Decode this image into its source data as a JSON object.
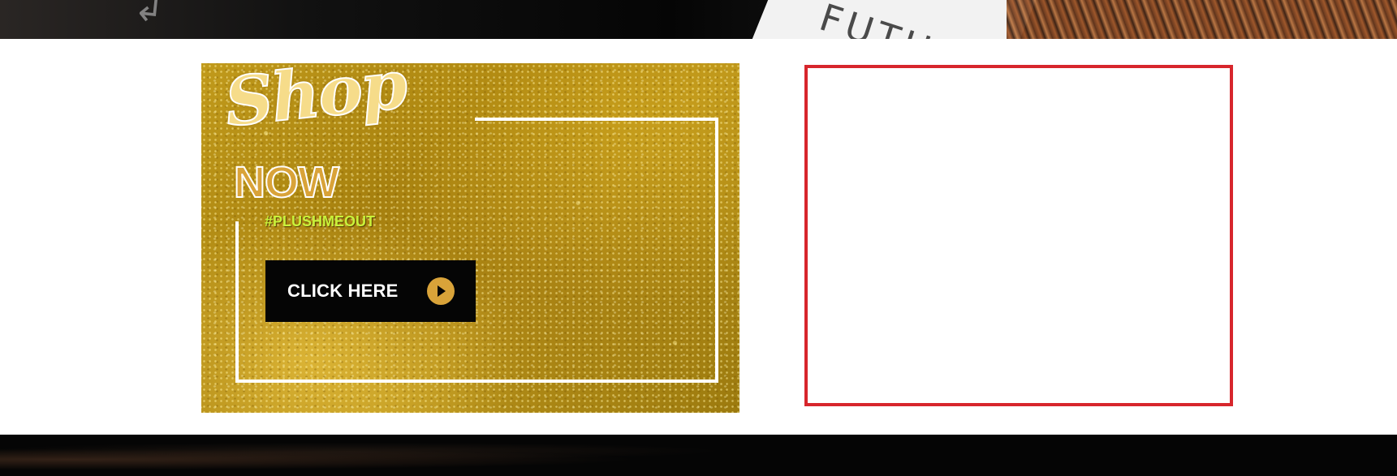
{
  "banner": {
    "script_word": "Shop",
    "headline": "NOW",
    "hashtag": "#PLUSHMEOUT",
    "cta_label": "CLICK HERE",
    "cta_icon": "play-circle-icon"
  },
  "colors": {
    "gold": "#d9a339",
    "hashtag_green": "#c9f23a",
    "cta_background": "#050505",
    "embed_border": "#d7262c",
    "page_background": "#ffffff"
  }
}
